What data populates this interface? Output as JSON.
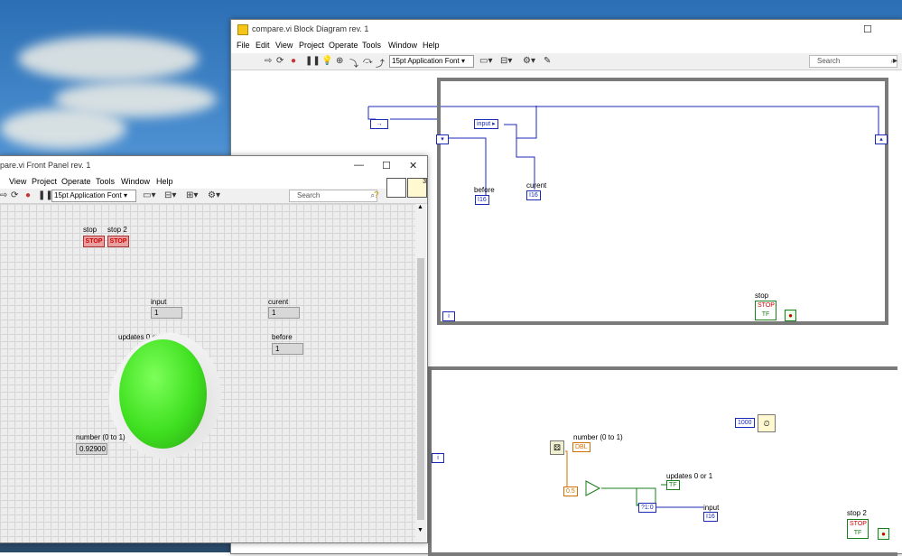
{
  "block_diagram": {
    "title": "compare.vi Block Diagram rev. 1",
    "menu": [
      "File",
      "Edit",
      "View",
      "Project",
      "Operate",
      "Tools",
      "Window",
      "Help"
    ],
    "font_select": "15pt Application Font",
    "search_placeholder": "Search",
    "loop1": {
      "input_local": "input",
      "before_label": "before",
      "before_type": "I16",
      "curent_label": "curent",
      "curent_type": "I16",
      "stop_label": "stop",
      "stop_text": "STOP",
      "tf": "TF",
      "iter": "i"
    },
    "loop2": {
      "number_label": "number (0 to 1)",
      "number_type": "DBL",
      "const_05": "0.5",
      "updates_label": "updates 0 or 1",
      "updates_type": "TF",
      "bool_to_int": "?1:0",
      "input_label": "input",
      "input_type": "I16",
      "wait_const": "1000",
      "stop_label": "stop 2",
      "stop_text": "STOP",
      "tf": "TF",
      "iter": "i"
    }
  },
  "front_panel": {
    "title": "pare.vi Front Panel rev. 1",
    "menu": [
      "View",
      "Project",
      "Operate",
      "Tools",
      "Window",
      "Help"
    ],
    "font_select": "15pt Application Font",
    "search_placeholder": "Search",
    "stop_label": "stop",
    "stop_text": "STOP",
    "stop2_label": "stop 2",
    "stop2_text": "STOP",
    "input_label": "input",
    "input_value": "1",
    "curent_label": "curent",
    "curent_value": "1",
    "updates_label": "updates 0 or 1",
    "before_label": "before",
    "before_value": "1",
    "number_label": "number (0 to 1)",
    "number_value": "0.92900",
    "led_color": "#3fe020",
    "connector_count": "3"
  }
}
